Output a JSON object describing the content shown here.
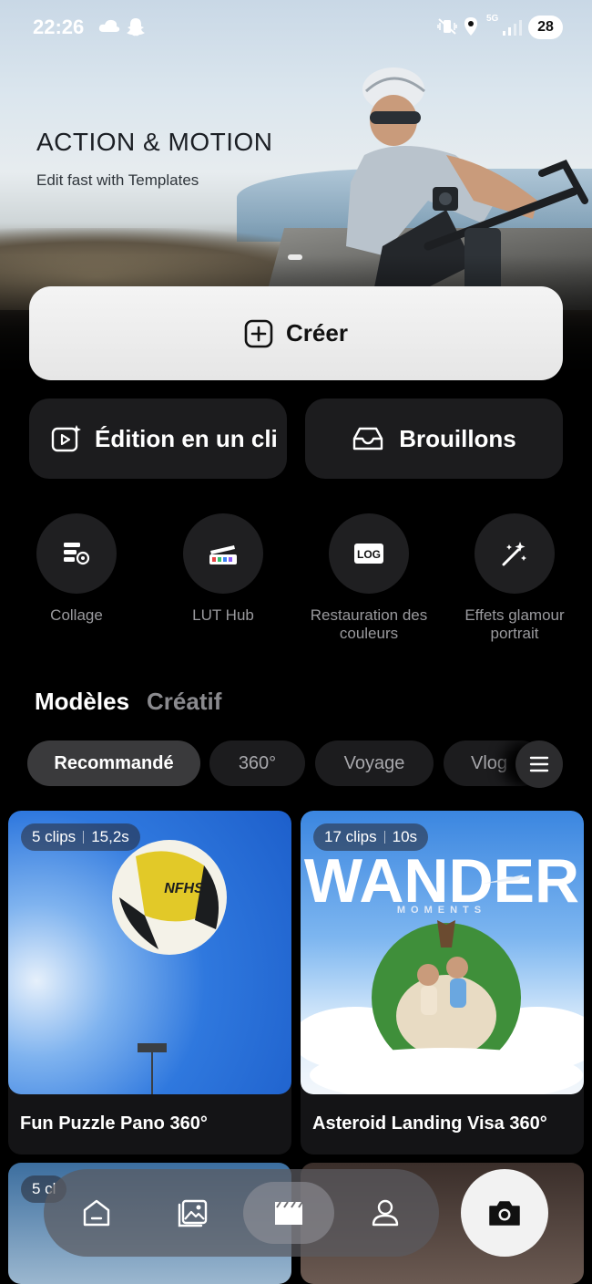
{
  "status_bar": {
    "time": "22:26",
    "network": "5G",
    "battery": "28"
  },
  "hero": {
    "title": "ACTION & MOTION",
    "subtitle": "Edit fast with Templates"
  },
  "actions": {
    "create_label": "Créer",
    "one_click_label": "Édition en un cli",
    "drafts_label": "Brouillons"
  },
  "tools": [
    {
      "label": "Collage",
      "icon": "collage-icon"
    },
    {
      "label": "LUT Hub",
      "icon": "lut-icon"
    },
    {
      "label": "Restauration des couleurs",
      "icon": "log-icon",
      "icon_text": "LOG"
    },
    {
      "label": "Effets glamour portrait",
      "icon": "magic-wand-icon"
    }
  ],
  "tabs": {
    "main": "Modèles",
    "secondary": "Créatif"
  },
  "chips": [
    {
      "label": "Recommandé",
      "active": true
    },
    {
      "label": "360°",
      "active": false
    },
    {
      "label": "Voyage",
      "active": false
    },
    {
      "label": "Vlog",
      "active": false
    }
  ],
  "cards": [
    {
      "clips": "5 clips",
      "duration": "15,2s",
      "title": "Fun Puzzle Pano 360°",
      "ball_text": "NFHS"
    },
    {
      "clips": "17 clips",
      "duration": "10s",
      "title": "Asteroid Landing Visa 360°",
      "art_title": "WANDER",
      "art_sub": "MOMENTS"
    },
    {
      "clips": "5 cl"
    }
  ],
  "nav": {
    "items": [
      "home-icon",
      "gallery-icon",
      "templates-icon",
      "profile-icon"
    ],
    "active": "templates-icon",
    "camera": "camera-icon"
  },
  "colors": {
    "background": "#000000",
    "card": "#141416",
    "button": "#1c1c1e",
    "create_bg": "#efefef"
  }
}
